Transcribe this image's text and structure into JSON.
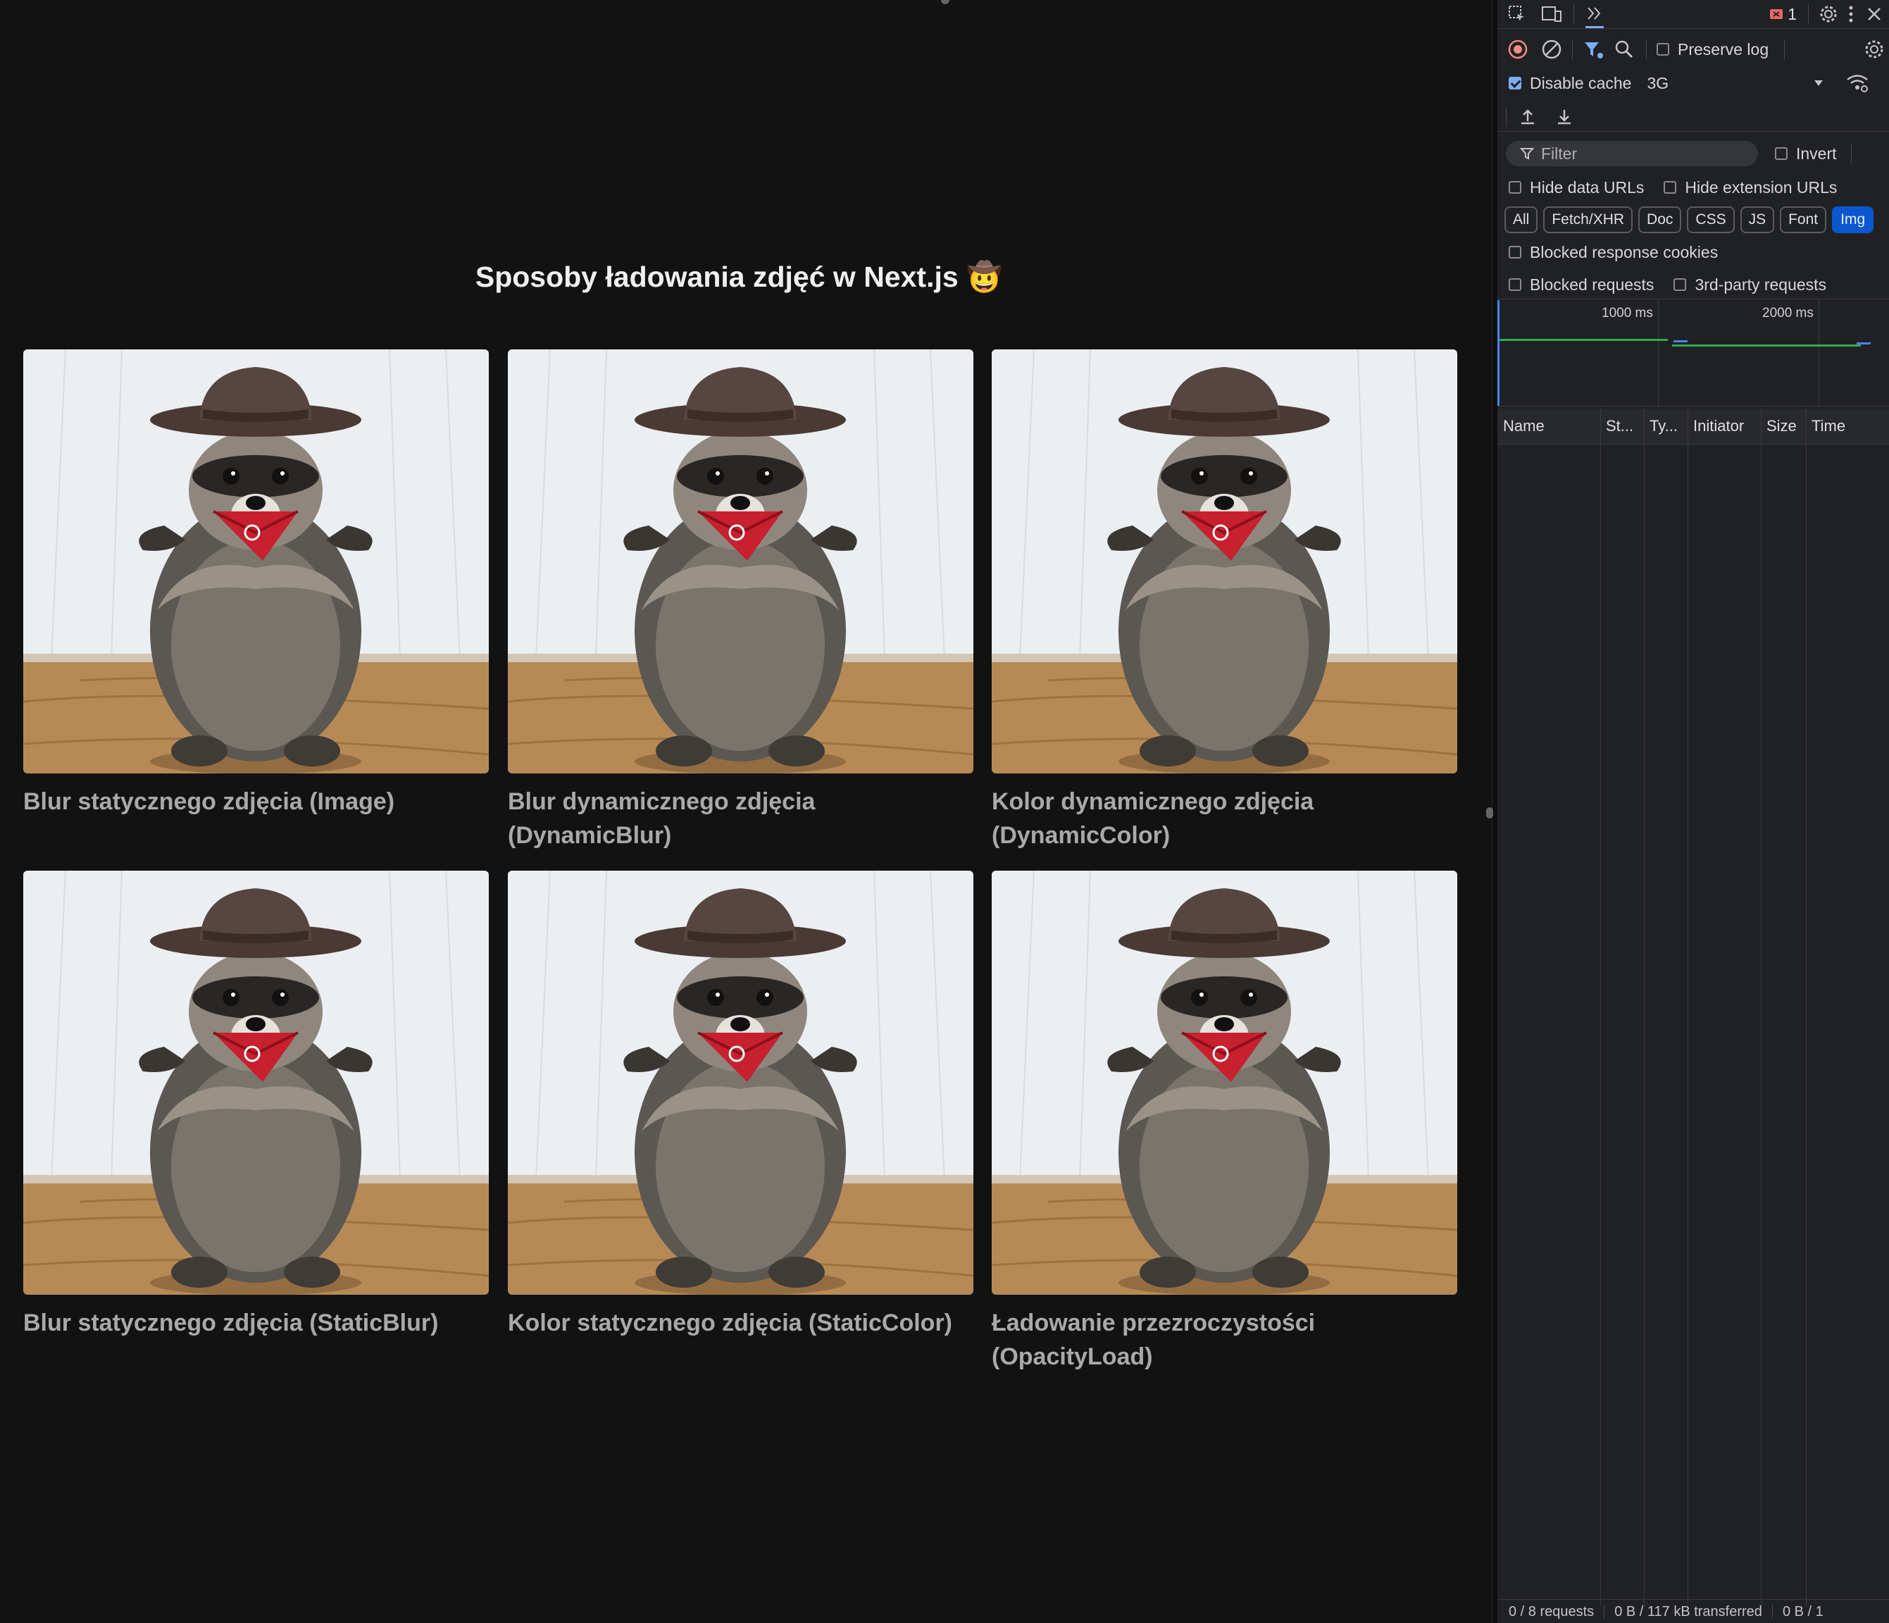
{
  "page": {
    "title": "Sposoby ładowania zdjęć w Next.js",
    "title_emoji": "🤠",
    "cards": [
      {
        "caption": "Blur statycznego zdjęcia (Image)"
      },
      {
        "caption": "Blur dynamicznego zdjęcia (DynamicBlur)"
      },
      {
        "caption": "Kolor dynamicznego zdjęcia (DynamicColor)"
      },
      {
        "caption": "Blur statycznego zdjęcia (StaticBlur)"
      },
      {
        "caption": "Kolor statycznego zdjęcia (StaticColor)"
      },
      {
        "caption": "Ładowanie przezroczystości (OpacityLoad)"
      }
    ]
  },
  "devtools": {
    "toolbar": {
      "error_count": "1",
      "preserve_log_label": "Preserve log",
      "preserve_log_checked": false,
      "disable_cache_label": "Disable cache",
      "disable_cache_checked": true,
      "throttling_value": "3G"
    },
    "filter": {
      "placeholder": "Filter",
      "invert_label": "Invert",
      "hide_data_urls_label": "Hide data URLs",
      "hide_extension_urls_label": "Hide extension URLs",
      "blocked_cookies_label": "Blocked response cookies",
      "blocked_requests_label": "Blocked requests",
      "third_party_label": "3rd-party requests"
    },
    "type_filters": [
      "All",
      "Fetch/XHR",
      "Doc",
      "CSS",
      "JS",
      "Font",
      "Img"
    ],
    "active_type_filter": "Img",
    "timeline": {
      "tick_1": "1000 ms",
      "tick_2": "2000 ms"
    },
    "columns": [
      "Name",
      "St...",
      "Ty...",
      "Initiator",
      "Size",
      "Time"
    ],
    "status_bar": {
      "requests": "0 / 8 requests",
      "transferred": "0 B / 117 kB transferred",
      "resources": "0 B / 1"
    },
    "colors": {
      "accent": "#0b57d0",
      "record": "#f28b82",
      "timeline_green": "#34a853",
      "timeline_blue": "#4285f4"
    }
  }
}
